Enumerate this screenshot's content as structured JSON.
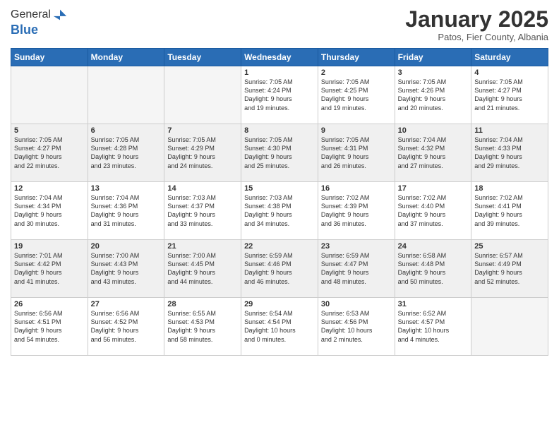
{
  "logo": {
    "general": "General",
    "blue": "Blue"
  },
  "header": {
    "month": "January 2025",
    "location": "Patos, Fier County, Albania"
  },
  "weekdays": [
    "Sunday",
    "Monday",
    "Tuesday",
    "Wednesday",
    "Thursday",
    "Friday",
    "Saturday"
  ],
  "weeks": [
    [
      {
        "day": "",
        "info": ""
      },
      {
        "day": "",
        "info": ""
      },
      {
        "day": "",
        "info": ""
      },
      {
        "day": "1",
        "info": "Sunrise: 7:05 AM\nSunset: 4:24 PM\nDaylight: 9 hours\nand 19 minutes."
      },
      {
        "day": "2",
        "info": "Sunrise: 7:05 AM\nSunset: 4:25 PM\nDaylight: 9 hours\nand 19 minutes."
      },
      {
        "day": "3",
        "info": "Sunrise: 7:05 AM\nSunset: 4:26 PM\nDaylight: 9 hours\nand 20 minutes."
      },
      {
        "day": "4",
        "info": "Sunrise: 7:05 AM\nSunset: 4:27 PM\nDaylight: 9 hours\nand 21 minutes."
      }
    ],
    [
      {
        "day": "5",
        "info": "Sunrise: 7:05 AM\nSunset: 4:27 PM\nDaylight: 9 hours\nand 22 minutes."
      },
      {
        "day": "6",
        "info": "Sunrise: 7:05 AM\nSunset: 4:28 PM\nDaylight: 9 hours\nand 23 minutes."
      },
      {
        "day": "7",
        "info": "Sunrise: 7:05 AM\nSunset: 4:29 PM\nDaylight: 9 hours\nand 24 minutes."
      },
      {
        "day": "8",
        "info": "Sunrise: 7:05 AM\nSunset: 4:30 PM\nDaylight: 9 hours\nand 25 minutes."
      },
      {
        "day": "9",
        "info": "Sunrise: 7:05 AM\nSunset: 4:31 PM\nDaylight: 9 hours\nand 26 minutes."
      },
      {
        "day": "10",
        "info": "Sunrise: 7:04 AM\nSunset: 4:32 PM\nDaylight: 9 hours\nand 27 minutes."
      },
      {
        "day": "11",
        "info": "Sunrise: 7:04 AM\nSunset: 4:33 PM\nDaylight: 9 hours\nand 29 minutes."
      }
    ],
    [
      {
        "day": "12",
        "info": "Sunrise: 7:04 AM\nSunset: 4:34 PM\nDaylight: 9 hours\nand 30 minutes."
      },
      {
        "day": "13",
        "info": "Sunrise: 7:04 AM\nSunset: 4:36 PM\nDaylight: 9 hours\nand 31 minutes."
      },
      {
        "day": "14",
        "info": "Sunrise: 7:03 AM\nSunset: 4:37 PM\nDaylight: 9 hours\nand 33 minutes."
      },
      {
        "day": "15",
        "info": "Sunrise: 7:03 AM\nSunset: 4:38 PM\nDaylight: 9 hours\nand 34 minutes."
      },
      {
        "day": "16",
        "info": "Sunrise: 7:02 AM\nSunset: 4:39 PM\nDaylight: 9 hours\nand 36 minutes."
      },
      {
        "day": "17",
        "info": "Sunrise: 7:02 AM\nSunset: 4:40 PM\nDaylight: 9 hours\nand 37 minutes."
      },
      {
        "day": "18",
        "info": "Sunrise: 7:02 AM\nSunset: 4:41 PM\nDaylight: 9 hours\nand 39 minutes."
      }
    ],
    [
      {
        "day": "19",
        "info": "Sunrise: 7:01 AM\nSunset: 4:42 PM\nDaylight: 9 hours\nand 41 minutes."
      },
      {
        "day": "20",
        "info": "Sunrise: 7:00 AM\nSunset: 4:43 PM\nDaylight: 9 hours\nand 43 minutes."
      },
      {
        "day": "21",
        "info": "Sunrise: 7:00 AM\nSunset: 4:45 PM\nDaylight: 9 hours\nand 44 minutes."
      },
      {
        "day": "22",
        "info": "Sunrise: 6:59 AM\nSunset: 4:46 PM\nDaylight: 9 hours\nand 46 minutes."
      },
      {
        "day": "23",
        "info": "Sunrise: 6:59 AM\nSunset: 4:47 PM\nDaylight: 9 hours\nand 48 minutes."
      },
      {
        "day": "24",
        "info": "Sunrise: 6:58 AM\nSunset: 4:48 PM\nDaylight: 9 hours\nand 50 minutes."
      },
      {
        "day": "25",
        "info": "Sunrise: 6:57 AM\nSunset: 4:49 PM\nDaylight: 9 hours\nand 52 minutes."
      }
    ],
    [
      {
        "day": "26",
        "info": "Sunrise: 6:56 AM\nSunset: 4:51 PM\nDaylight: 9 hours\nand 54 minutes."
      },
      {
        "day": "27",
        "info": "Sunrise: 6:56 AM\nSunset: 4:52 PM\nDaylight: 9 hours\nand 56 minutes."
      },
      {
        "day": "28",
        "info": "Sunrise: 6:55 AM\nSunset: 4:53 PM\nDaylight: 9 hours\nand 58 minutes."
      },
      {
        "day": "29",
        "info": "Sunrise: 6:54 AM\nSunset: 4:54 PM\nDaylight: 10 hours\nand 0 minutes."
      },
      {
        "day": "30",
        "info": "Sunrise: 6:53 AM\nSunset: 4:56 PM\nDaylight: 10 hours\nand 2 minutes."
      },
      {
        "day": "31",
        "info": "Sunrise: 6:52 AM\nSunset: 4:57 PM\nDaylight: 10 hours\nand 4 minutes."
      },
      {
        "day": "",
        "info": ""
      }
    ]
  ]
}
